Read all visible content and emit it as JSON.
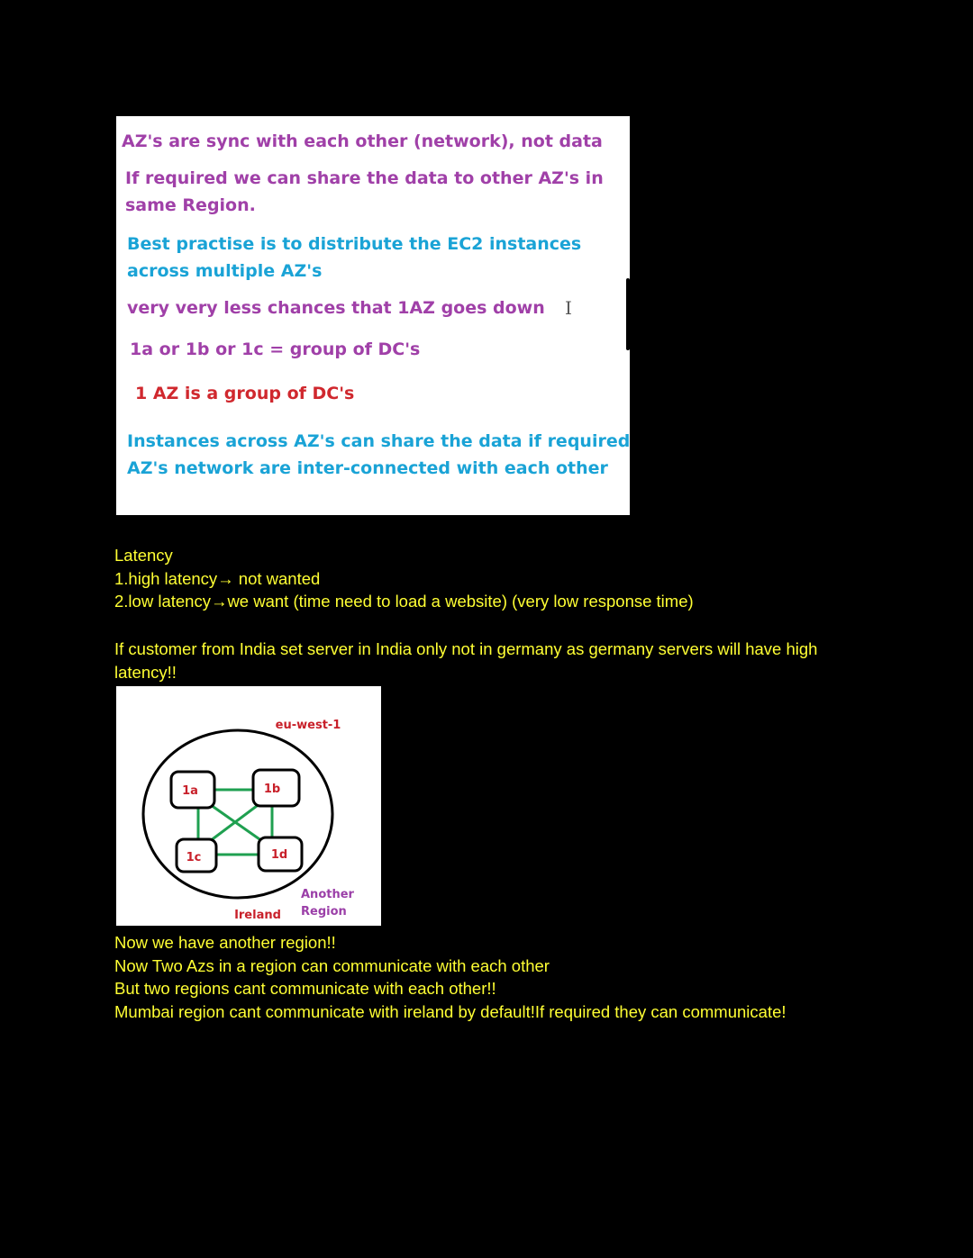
{
  "slide": {
    "lines": [
      "AZ's are sync with each other (network), not data",
      "If required we can share the data to other AZ's in",
      "same Region.",
      "Best practise is to distribute the EC2 instances",
      "across multiple AZ's",
      "very very less chances that 1AZ goes down",
      "1a or 1b or 1c = group of DC's",
      "1 AZ is a group of DC's",
      "Instances across AZ's can share the data if required as",
      "AZ's network are inter-connected with each other"
    ],
    "cursor_glyph": "I",
    "colors": {
      "purple": "#a040a8",
      "blue": "#1aa3d6",
      "red": "#d0282e"
    }
  },
  "notes": {
    "latency_title": "Latency",
    "latency_1": "1.high latency→ not wanted",
    "latency_2": "2.low latency→we want (time need to load a website) (very low response time)",
    "india_note": "If customer from India set server in India only not in germany as germany servers will have high latency!!",
    "another_region": "Now we have another region!!",
    "two_azs": "Now Two Azs in a region can communicate with each other",
    "two_regions": "But two regions cant communicate with each other!!",
    "mumbai": "Mumbai region cant communicate with ireland by default!If required they can communicate!",
    "text_color": "#ffff33"
  },
  "diagram": {
    "region_code": "eu-west-1",
    "az_labels": [
      "1a",
      "1b",
      "1c",
      "1d"
    ],
    "region_name": "Ireland",
    "another_region_line1": "Another",
    "another_region_line2": "Region",
    "colors": {
      "link": "#1fa050",
      "label_red": "#c8202a",
      "label_purple": "#9b3fa8"
    }
  }
}
